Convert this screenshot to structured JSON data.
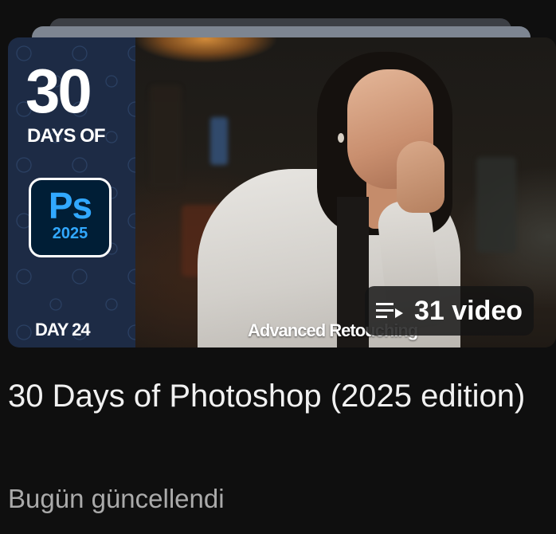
{
  "playlist": {
    "thumbnail": {
      "number": "30",
      "days_of": "DAYS OF",
      "app_badge": "Ps",
      "year": "2025",
      "day": "DAY 24",
      "lesson": "Advanced Retouching"
    },
    "video_count": "31 video",
    "title": "30 Days of Photoshop (2025 edition)",
    "updated": "Bugün güncellendi"
  },
  "icons": {
    "playlist": "playlist-icon"
  },
  "colors": {
    "background": "#0f0f0f",
    "ps_blue": "#31a8ff",
    "ps_dark": "#001e36",
    "panel": "#1d2b45",
    "subtitle": "#aaaaaa"
  }
}
